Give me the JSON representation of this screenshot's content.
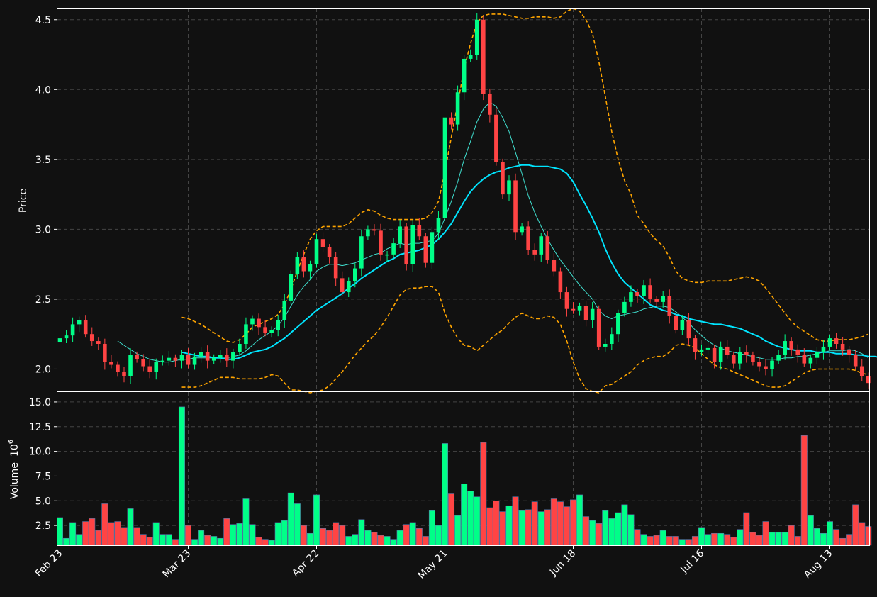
{
  "chart_data": {
    "type": "candlestick",
    "colors": {
      "background": "#111111",
      "up": "#00ff88",
      "down": "#ff4444",
      "grid": "#444444",
      "bollinger": "#ffa500",
      "ma_fast": "#40e0d0",
      "ma_slow": "#00e5ff"
    },
    "price_panel": {
      "ylabel": "Price",
      "ylim": [
        1.84,
        4.58
      ],
      "yticks": [
        2.0,
        2.5,
        3.0,
        3.5,
        4.0,
        4.5
      ],
      "ytick_labels": [
        "2.0",
        "2.5",
        "3.0",
        "3.5",
        "4.0",
        "4.5"
      ]
    },
    "volume_panel": {
      "ylabel": "Volume",
      "ylabel_exponent": "10",
      "ylabel_exponent_power": "6",
      "ylim": [
        0.5,
        16.0
      ],
      "yticks": [
        2.5,
        5.0,
        7.5,
        10.0,
        12.5,
        15.0
      ],
      "ytick_labels": [
        "2.5",
        "5.0",
        "7.5",
        "10.0",
        "12.5",
        "15.0"
      ]
    },
    "x_axis": {
      "tick_indices": [
        0,
        20,
        40,
        60,
        80,
        100,
        120
      ],
      "tick_labels": [
        "Feb 23",
        "Mar 23",
        "Apr 22",
        "May 21",
        "Jun 18",
        "Jul 16",
        "Aug 13"
      ],
      "grid": true
    },
    "volume_data": [
      3.3,
      1.2,
      2.8,
      1.6,
      2.9,
      3.2,
      2.0,
      4.7,
      2.8,
      2.9,
      2.3,
      4.2,
      2.3,
      1.6,
      1.3,
      2.8,
      1.6,
      1.6,
      1.1,
      14.5,
      2.5,
      1.1,
      2.0,
      1.5,
      1.4,
      1.2,
      3.2,
      2.6,
      2.7,
      5.2,
      2.6,
      1.3,
      1.1,
      1.0,
      2.8,
      3.0,
      5.8,
      4.7,
      2.5,
      1.7,
      5.6,
      2.2,
      2.0,
      2.8,
      2.5,
      1.4,
      1.6,
      3.1,
      2.0,
      1.8,
      1.5,
      1.4,
      1.1,
      2.0,
      2.6,
      2.8,
      2.2,
      1.4,
      4.0,
      2.5,
      10.8,
      5.7,
      3.5,
      6.7,
      6.0,
      5.4,
      10.9,
      4.3,
      5.0,
      3.9,
      4.5,
      5.4,
      4.0,
      4.1,
      4.9,
      3.9,
      4.1,
      5.2,
      4.9,
      4.4,
      5.1,
      5.6,
      3.4,
      3.0,
      2.7,
      4.0,
      3.2,
      3.8,
      4.6,
      3.6,
      2.1,
      1.6,
      1.4,
      1.5,
      2.0,
      1.4,
      1.4,
      1.1,
      1.1,
      1.4,
      2.3,
      1.6,
      1.7,
      1.7,
      1.6,
      1.3,
      2.1,
      3.8,
      1.8,
      1.5,
      2.9,
      1.8,
      1.8,
      1.8,
      2.5,
      1.4,
      11.6,
      3.5,
      2.2,
      1.7,
      2.9,
      2.1,
      1.2,
      1.6,
      4.6,
      2.8,
      2.4
    ],
    "close_data": [
      2.22,
      2.24,
      2.32,
      2.35,
      2.25,
      2.2,
      2.18,
      2.05,
      2.03,
      1.98,
      1.95,
      2.1,
      2.07,
      2.02,
      1.98,
      2.05,
      2.06,
      2.08,
      2.06,
      2.1,
      2.03,
      2.09,
      2.12,
      2.06,
      2.08,
      2.1,
      2.06,
      2.12,
      2.18,
      2.32,
      2.36,
      2.3,
      2.26,
      2.28,
      2.35,
      2.49,
      2.68,
      2.8,
      2.7,
      2.75,
      2.93,
      2.87,
      2.8,
      2.65,
      2.55,
      2.63,
      2.72,
      2.95,
      3.0,
      2.99,
      2.82,
      2.82,
      2.9,
      3.02,
      2.75,
      3.03,
      2.95,
      2.76,
      2.98,
      3.08,
      3.8,
      3.75,
      3.98,
      4.22,
      4.25,
      4.5,
      3.97,
      3.82,
      3.48,
      3.25,
      3.35,
      2.98,
      3.02,
      2.85,
      2.82,
      2.95,
      2.78,
      2.7,
      2.55,
      2.43,
      2.42,
      2.45,
      2.35,
      2.43,
      2.16,
      2.18,
      2.25,
      2.4,
      2.48,
      2.55,
      2.52,
      2.6,
      2.5,
      2.48,
      2.52,
      2.38,
      2.28,
      2.35,
      2.22,
      2.12,
      2.14,
      2.15,
      2.05,
      2.16,
      2.1,
      2.04,
      2.12,
      2.1,
      2.05,
      2.02,
      2.0,
      2.06,
      2.1,
      2.2,
      2.14,
      2.1,
      2.04,
      2.08,
      2.12,
      2.16,
      2.22,
      2.18,
      2.14,
      2.1,
      2.02,
      1.95,
      1.9
    ],
    "ma_fast_data": [
      null,
      null,
      null,
      null,
      null,
      null,
      null,
      null,
      null,
      2.2,
      2.17,
      2.14,
      2.11,
      2.09,
      2.07,
      2.06,
      2.05,
      2.05,
      2.06,
      2.07,
      2.07,
      2.08,
      2.08,
      2.08,
      2.08,
      2.09,
      2.08,
      2.09,
      2.1,
      2.13,
      2.17,
      2.21,
      2.24,
      2.27,
      2.31,
      2.37,
      2.45,
      2.53,
      2.59,
      2.64,
      2.7,
      2.73,
      2.75,
      2.75,
      2.74,
      2.75,
      2.76,
      2.78,
      2.8,
      2.82,
      2.83,
      2.86,
      2.88,
      2.9,
      2.89,
      2.9,
      2.9,
      2.91,
      2.92,
      2.97,
      3.08,
      3.2,
      3.34,
      3.5,
      3.63,
      3.77,
      3.86,
      3.91,
      3.88,
      3.8,
      3.7,
      3.55,
      3.4,
      3.24,
      3.12,
      3.02,
      2.93,
      2.85,
      2.78,
      2.72,
      2.66,
      2.6,
      2.55,
      2.5,
      2.42,
      2.38,
      2.36,
      2.38,
      2.39,
      2.4,
      2.41,
      2.43,
      2.44,
      2.45,
      2.45,
      2.44,
      2.41,
      2.37,
      2.33,
      2.28,
      2.24,
      2.2,
      2.17,
      2.15,
      2.13,
      2.12,
      2.11,
      2.1,
      2.09,
      2.08,
      2.07,
      2.07,
      2.07,
      2.08,
      2.08,
      2.09,
      2.09,
      2.1,
      2.11,
      2.12,
      2.13,
      2.13,
      2.13,
      2.14,
      2.13,
      2.11,
      2.08
    ],
    "ma_slow_data": [
      null,
      null,
      null,
      null,
      null,
      null,
      null,
      null,
      null,
      null,
      null,
      null,
      null,
      null,
      null,
      null,
      null,
      null,
      null,
      2.12,
      2.11,
      2.1,
      2.09,
      2.09,
      2.08,
      2.08,
      2.07,
      2.07,
      2.08,
      2.1,
      2.12,
      2.13,
      2.14,
      2.16,
      2.19,
      2.22,
      2.26,
      2.3,
      2.34,
      2.38,
      2.42,
      2.45,
      2.48,
      2.51,
      2.54,
      2.58,
      2.61,
      2.65,
      2.68,
      2.71,
      2.74,
      2.77,
      2.79,
      2.82,
      2.83,
      2.84,
      2.85,
      2.87,
      2.89,
      2.93,
      2.98,
      3.04,
      3.12,
      3.2,
      3.27,
      3.32,
      3.36,
      3.39,
      3.41,
      3.42,
      3.44,
      3.45,
      3.46,
      3.46,
      3.45,
      3.45,
      3.45,
      3.44,
      3.43,
      3.4,
      3.34,
      3.25,
      3.17,
      3.08,
      2.98,
      2.86,
      2.76,
      2.68,
      2.62,
      2.58,
      2.54,
      2.5,
      2.46,
      2.44,
      2.42,
      2.41,
      2.39,
      2.38,
      2.36,
      2.35,
      2.34,
      2.33,
      2.32,
      2.32,
      2.31,
      2.3,
      2.29,
      2.27,
      2.25,
      2.23,
      2.2,
      2.18,
      2.16,
      2.15,
      2.14,
      2.13,
      2.13,
      2.13,
      2.12,
      2.12,
      2.12,
      2.11,
      2.11,
      2.11,
      2.1,
      2.1,
      2.09,
      2.09,
      2.08
    ],
    "bb_upper_data": [
      null,
      null,
      null,
      null,
      null,
      null,
      null,
      null,
      null,
      null,
      null,
      null,
      null,
      null,
      null,
      null,
      null,
      null,
      null,
      2.37,
      2.36,
      2.34,
      2.32,
      2.29,
      2.26,
      2.23,
      2.2,
      2.19,
      2.21,
      2.25,
      2.3,
      2.32,
      2.34,
      2.36,
      2.39,
      2.46,
      2.57,
      2.7,
      2.82,
      2.93,
      2.99,
      3.02,
      3.02,
      3.02,
      3.02,
      3.04,
      3.08,
      3.12,
      3.14,
      3.13,
      3.1,
      3.08,
      3.07,
      3.07,
      3.07,
      3.07,
      3.07,
      3.08,
      3.12,
      3.2,
      3.41,
      3.66,
      3.9,
      4.15,
      4.33,
      4.48,
      4.53,
      4.54,
      4.54,
      4.54,
      4.53,
      4.52,
      4.51,
      4.51,
      4.52,
      4.52,
      4.52,
      4.51,
      4.52,
      4.56,
      4.58,
      4.56,
      4.5,
      4.4,
      4.2,
      3.95,
      3.7,
      3.5,
      3.35,
      3.25,
      3.1,
      3.04,
      2.97,
      2.92,
      2.88,
      2.8,
      2.7,
      2.65,
      2.63,
      2.62,
      2.62,
      2.63,
      2.63,
      2.63,
      2.63,
      2.64,
      2.65,
      2.66,
      2.65,
      2.63,
      2.58,
      2.52,
      2.46,
      2.4,
      2.34,
      2.3,
      2.27,
      2.24,
      2.21,
      2.2,
      2.2,
      2.21,
      2.21,
      2.21,
      2.22,
      2.23,
      2.25
    ],
    "bb_lower_data": [
      null,
      null,
      null,
      null,
      null,
      null,
      null,
      null,
      null,
      null,
      null,
      null,
      null,
      null,
      null,
      null,
      null,
      null,
      null,
      1.87,
      1.87,
      1.87,
      1.88,
      1.9,
      1.92,
      1.94,
      1.94,
      1.94,
      1.93,
      1.93,
      1.93,
      1.93,
      1.94,
      1.96,
      1.95,
      1.9,
      1.85,
      1.85,
      1.84,
      1.83,
      1.84,
      1.85,
      1.88,
      1.93,
      1.98,
      2.04,
      2.1,
      2.15,
      2.2,
      2.24,
      2.3,
      2.37,
      2.45,
      2.53,
      2.57,
      2.58,
      2.58,
      2.59,
      2.59,
      2.55,
      2.4,
      2.3,
      2.22,
      2.17,
      2.16,
      2.13,
      2.17,
      2.21,
      2.25,
      2.28,
      2.33,
      2.37,
      2.4,
      2.38,
      2.36,
      2.36,
      2.38,
      2.37,
      2.32,
      2.2,
      2.05,
      1.93,
      1.86,
      1.84,
      1.83,
      1.88,
      1.89,
      1.92,
      1.95,
      1.98,
      2.03,
      2.06,
      2.08,
      2.09,
      2.09,
      2.12,
      2.17,
      2.18,
      2.17,
      2.15,
      2.11,
      2.07,
      2.03,
      2.01,
      2.0,
      1.98,
      1.96,
      1.94,
      1.92,
      1.9,
      1.88,
      1.87,
      1.87,
      1.88,
      1.91,
      1.94,
      1.97,
      1.99,
      2.0,
      2.0,
      2.0,
      2.0,
      2.0,
      2.0,
      1.99,
      1.97,
      1.96
    ]
  }
}
